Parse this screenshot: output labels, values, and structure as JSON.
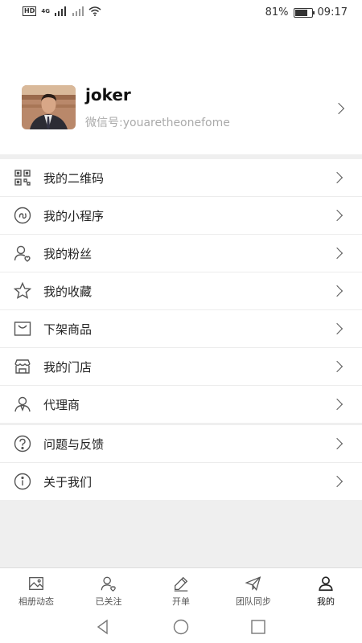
{
  "status": {
    "signal": "4G",
    "battery": "81%",
    "battery_level": 0.81,
    "time": "09:17"
  },
  "profile": {
    "name": "joker",
    "wechat": "微信号:youaretheonefome"
  },
  "menu_group_1": [
    {
      "label": "我的二维码",
      "icon": "qr-code-icon"
    },
    {
      "label": "我的小程序",
      "icon": "mini-program-icon"
    },
    {
      "label": "我的粉丝",
      "icon": "followers-icon"
    },
    {
      "label": "我的收藏",
      "icon": "star-icon"
    },
    {
      "label": "下架商品",
      "icon": "bag-icon"
    },
    {
      "label": "我的门店",
      "icon": "store-icon"
    },
    {
      "label": "代理商",
      "icon": "agent-icon"
    }
  ],
  "menu_group_2": [
    {
      "label": "问题与反馈",
      "icon": "question-icon"
    },
    {
      "label": "关于我们",
      "icon": "info-icon"
    }
  ],
  "tabs": [
    {
      "label": "相册动态",
      "icon": "image-icon"
    },
    {
      "label": "已关注",
      "icon": "followed-icon"
    },
    {
      "label": "开单",
      "icon": "pen-icon"
    },
    {
      "label": "团队同步",
      "icon": "paper-plane-icon"
    },
    {
      "label": "我的",
      "icon": "user-icon"
    }
  ]
}
